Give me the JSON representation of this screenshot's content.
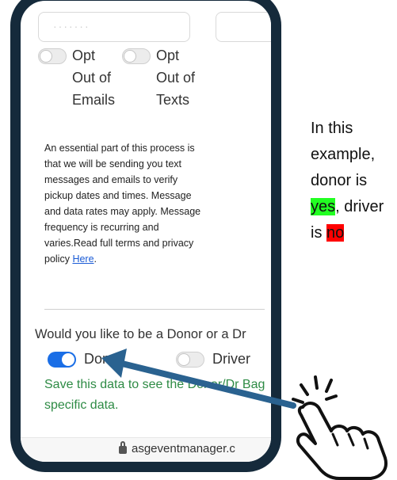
{
  "form": {
    "opt_out_emails": {
      "label": "Opt Out of Emails",
      "on": false
    },
    "opt_out_texts": {
      "label": "Opt Out of Texts",
      "on": false
    },
    "disclaimer": {
      "text": "An essential part of this process is that we will be sending you text messages and emails to verify pickup dates and times. Message and data rates may apply. Message frequency is recurring and varies.Read full terms and privacy policy ",
      "link_text": "Here",
      "end": "."
    },
    "role_question": "Would you like to be a Donor or a Dr",
    "donor": {
      "label": "Donor",
      "on": true
    },
    "driver": {
      "label": "Driver",
      "on": false
    },
    "save_message": "Save this data to see the Donor/Dr Bag specific data."
  },
  "browser": {
    "url": "asgeventmanager.c"
  },
  "callout": {
    "line1": "In this example, donor is",
    "yes": "yes",
    "line2": ", driver is",
    "no": "no"
  },
  "colors": {
    "phone_frame": "#152a3b",
    "toggle_on": "#1a6ee6",
    "save_text": "#2e8b45",
    "highlight_yes": "#22ff22",
    "highlight_no": "#ff0000",
    "arrow": "#2a6290"
  },
  "icons": {
    "pointer": "hand-pointer-icon",
    "lock": "lock-icon"
  }
}
